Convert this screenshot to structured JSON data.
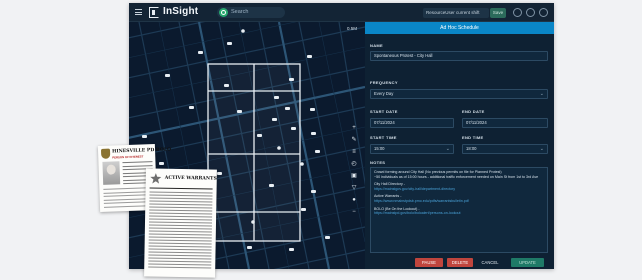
{
  "app": {
    "title": "InSight",
    "search_placeholder": "Search",
    "user_select": "ResourceUser current shift",
    "save_label": "Save"
  },
  "map": {
    "scale_label": "0.5M"
  },
  "panel": {
    "header": "Ad Hoc Schedule",
    "name_label": "NAME",
    "name_value": "Spontaneous Protest - City Hall",
    "frequency_label": "FREQUENCY",
    "frequency_value": "Every Day",
    "start_date_label": "START DATE",
    "start_date_value": "07/11/2024",
    "end_date_label": "END DATE",
    "end_date_value": "07/11/2024",
    "start_time_label": "START TIME",
    "start_time_value": "15:00",
    "end_time_label": "END TIME",
    "end_time_value": "18:00",
    "notes_label": "NOTES",
    "notes": {
      "line1": "Crowd forming around City Hall (No previous permits on file for Planned Protest)",
      "line2": "~50 individuals as of 15:00 hours - additional traffic enforcement needed on Main St from 1st to 3rd Ave",
      "city_hall_heading": "City Hall Directory -",
      "city_hall_link": "https://mainstgov.gov/city-hall/department-directory",
      "warrants_heading": "Active Warrants -",
      "warrants_link": "https://www.nmainstpdsb.pmo.edu/pdfs/warrantsbulletin.pdf",
      "bolo_heading": "BOLO (Be On the Lookout) -",
      "bolo_link": "https://mainstpd.gov/bolo/boloalert/persons-on-lookout"
    },
    "buttons": {
      "pause": "PAUSE",
      "delete": "DELETE",
      "cancel": "CANCEL",
      "update": "UPDATE"
    }
  },
  "bolo_doc": {
    "title": "HINESVILLE PD BOLO",
    "subtitle": "PERSON OF INTEREST"
  },
  "warrants_doc": {
    "title": "ACTIVE WARRANTS"
  },
  "colors": {
    "accent": "#0a86c7",
    "danger": "#c0453d",
    "confirm": "#1f7a67",
    "map_background": "#0b1a2e"
  }
}
